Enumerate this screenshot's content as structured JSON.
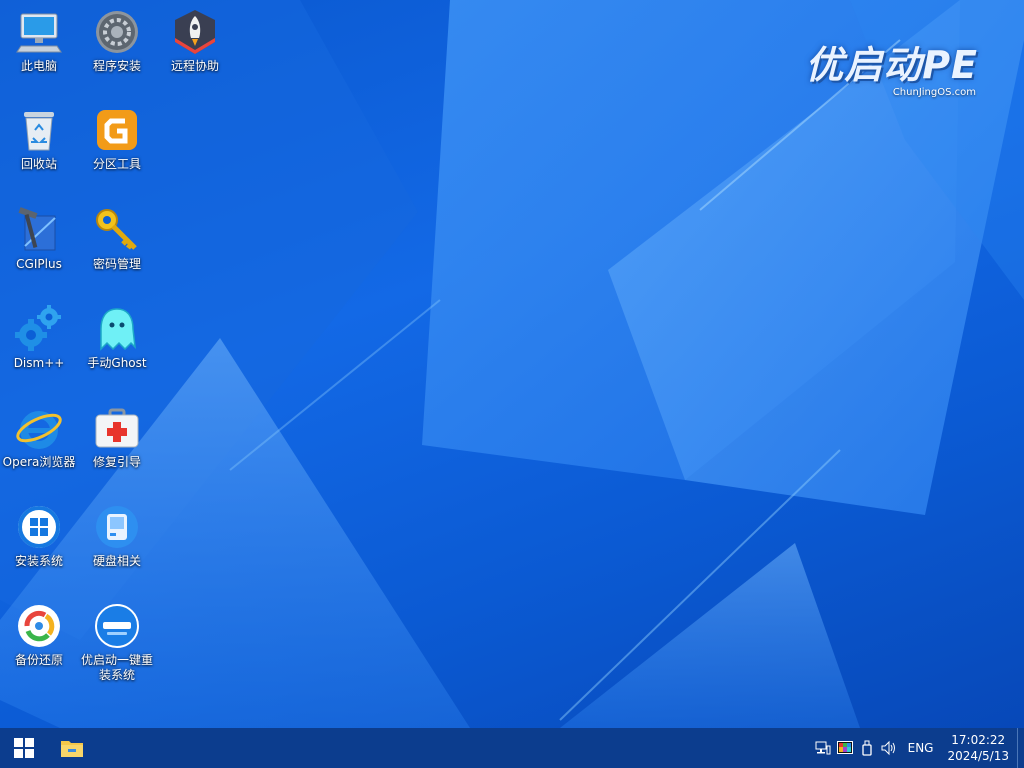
{
  "desktop": {
    "icons": [
      {
        "label": "此电脑",
        "icon": "computer-icon"
      },
      {
        "label": "程序安装",
        "icon": "settings-gear-icon"
      },
      {
        "label": "远程协助",
        "icon": "rocket-icon"
      },
      {
        "label": "回收站",
        "icon": "recycle-bin-icon"
      },
      {
        "label": "分区工具",
        "icon": "diskgenius-icon"
      },
      {
        "label": "CGIPlus",
        "icon": "hammer-ruler-icon"
      },
      {
        "label": "密码管理",
        "icon": "key-icon"
      },
      {
        "label": "Dism++",
        "icon": "gears-icon"
      },
      {
        "label": "手动Ghost",
        "icon": "ghost-icon"
      },
      {
        "label": "Opera浏览器",
        "icon": "ie-browser-icon"
      },
      {
        "label": "修复引导",
        "icon": "first-aid-kit-icon"
      },
      {
        "label": "安装系统",
        "icon": "windows-install-icon"
      },
      {
        "label": "硬盘相关",
        "icon": "hard-disk-icon"
      },
      {
        "label": "备份还原",
        "icon": "backup-restore-icon"
      },
      {
        "label": "优启动一键重装系统",
        "icon": "youqidong-icon"
      }
    ]
  },
  "logo": {
    "title": "优启动PE",
    "subtitle": "ChunJingOS.com"
  },
  "taskbar": {
    "start_icon": "windows-start-icon",
    "pinned": [
      "file-explorer-icon"
    ],
    "tray_icons": [
      "network-icon",
      "color-display-icon",
      "usb-icon",
      "volume-icon"
    ],
    "language": "ENG",
    "time": "17:02:22",
    "date": "2024/5/13"
  },
  "colors": {
    "wallpaper": "#0b5fd6",
    "taskbar": "#0c3d8e"
  }
}
